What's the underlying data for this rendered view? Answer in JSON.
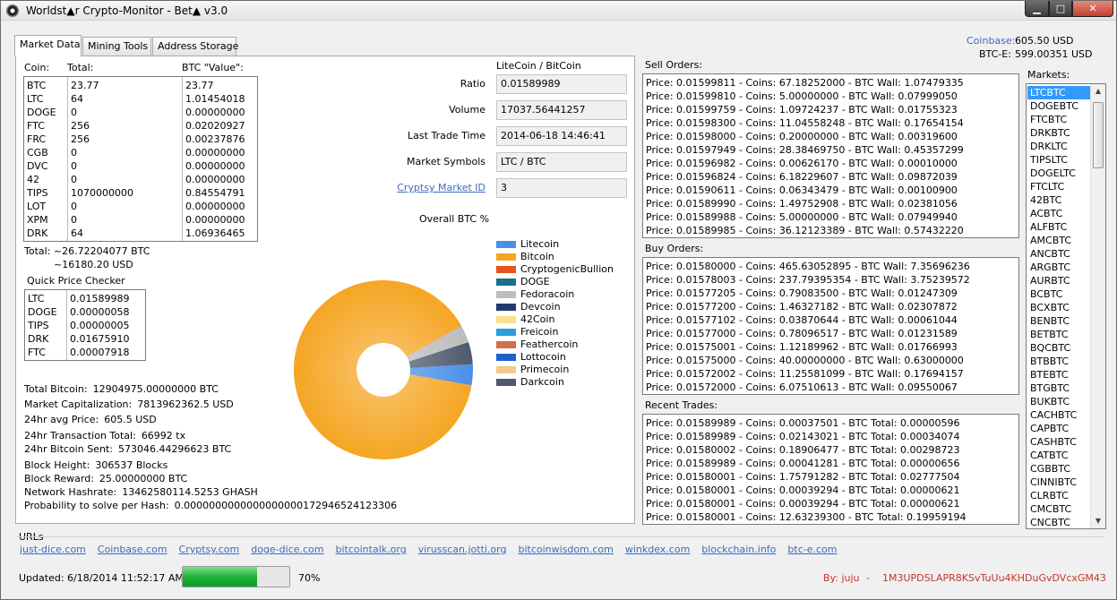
{
  "window": {
    "title": "Worldst▲r Crypto-Monitor - Bet▲ v3.0",
    "min_glyph": "▁",
    "max_glyph": "□",
    "close_glyph": "✕"
  },
  "tabs": [
    "Market Data",
    "Mining Tools",
    "Address Storage"
  ],
  "exchange_prices": {
    "coinbase_label": "Coinbase:",
    "coinbase_value": "605.50 USD",
    "btce_label": "BTC-E:",
    "btce_value": "599.00351 USD"
  },
  "portfolio": {
    "headers": [
      "Coin:",
      "Total:",
      "BTC \"Value\":"
    ],
    "rows": [
      {
        "coin": "BTC",
        "total": "23.77",
        "value": "23.77"
      },
      {
        "coin": "LTC",
        "total": "64",
        "value": "1.01454018"
      },
      {
        "coin": "DOGE",
        "total": "0",
        "value": "0.00000000"
      },
      {
        "coin": "FTC",
        "total": "256",
        "value": "0.02020927"
      },
      {
        "coin": "FRC",
        "total": "256",
        "value": "0.00237876"
      },
      {
        "coin": "CGB",
        "total": "0",
        "value": "0.00000000"
      },
      {
        "coin": "DVC",
        "total": "0",
        "value": "0.00000000"
      },
      {
        "coin": "42",
        "total": "0",
        "value": "0.00000000"
      },
      {
        "coin": "TIPS",
        "total": "1070000000",
        "value": "0.84554791"
      },
      {
        "coin": "LOT",
        "total": "0",
        "value": "0.00000000"
      },
      {
        "coin": "XPM",
        "total": "0",
        "value": "0.00000000"
      },
      {
        "coin": "DRK",
        "total": "64",
        "value": "1.06936465"
      }
    ],
    "total_btc": "Total:  ~26.72204077 BTC",
    "total_usd": "~16180.20 USD"
  },
  "quick_price": {
    "title": "Quick Price Checker",
    "rows": [
      {
        "coin": "LTC",
        "price": "0.01589989"
      },
      {
        "coin": "DOGE",
        "price": "0.00000058"
      },
      {
        "coin": "TIPS",
        "price": "0.00000005"
      },
      {
        "coin": "DRK",
        "price": "0.01675910"
      },
      {
        "coin": "FTC",
        "price": "0.00007918"
      }
    ]
  },
  "network_stats": [
    {
      "label": "Total Bitcoin:",
      "value": "12904975.00000000 BTC"
    },
    {
      "label": "Market Capitalization:",
      "value": "7813962362.5 USD"
    },
    {
      "label": "24hr avg Price:",
      "value": "605.5 USD"
    },
    {
      "label": "24hr Transaction Total:",
      "value": "66992 tx"
    },
    {
      "label": "24hr Bitcoin Sent:",
      "value": "573046.44296623 BTC"
    },
    {
      "label": "Block Height:",
      "value": "306537 Blocks"
    },
    {
      "label": "Block Reward:",
      "value": "25.00000000 BTC"
    },
    {
      "label": "Network Hashrate:",
      "value": "13462580114.5253 GHASH"
    },
    {
      "label": "Probability to solve per Hash:",
      "value": "0.0000000000000000000172946524123306"
    }
  ],
  "market": {
    "pair_title": "LiteCoin / BitCoin",
    "fields": [
      {
        "label": "Ratio",
        "value": "0.01589989"
      },
      {
        "label": "Volume",
        "value": "17037.56441257"
      },
      {
        "label": "Last Trade Time",
        "value": "2014-06-18 14:46:41"
      },
      {
        "label": "Market Symbols",
        "value": "LTC / BTC"
      },
      {
        "label": "Cryptsy Market ID",
        "value": "3"
      }
    ],
    "overall_label": "Overall BTC %"
  },
  "legend": [
    {
      "name": "Litecoin",
      "color": "#4a8fe7"
    },
    {
      "name": "Bitcoin",
      "color": "#f5a623"
    },
    {
      "name": "CryptogenicBullion",
      "color": "#e8541a"
    },
    {
      "name": "DOGE",
      "color": "#1a6f8f"
    },
    {
      "name": "Fedoracoin",
      "color": "#bdbdbd"
    },
    {
      "name": "Devcoin",
      "color": "#223a6e"
    },
    {
      "name": "42Coin",
      "color": "#f9e08a"
    },
    {
      "name": "Freicoin",
      "color": "#2a9fd8"
    },
    {
      "name": "Feathercoin",
      "color": "#d0704a"
    },
    {
      "name": "Lottocoin",
      "color": "#1d62c9"
    },
    {
      "name": "Primecoin",
      "color": "#f5c98a"
    },
    {
      "name": "Darkcoin",
      "color": "#4d5a6e"
    }
  ],
  "pie": {
    "slices": [
      {
        "name": "Bitcoin",
        "percent": 88.95,
        "color": "#f5a623"
      },
      {
        "name": "Litecoin",
        "percent": 3.8,
        "color": "#4a8fe7"
      },
      {
        "name": "Darkcoin",
        "percent": 4.0,
        "color": "#4d5a6e"
      },
      {
        "name": "TIPS",
        "percent": 3.16,
        "color": "#bdbdbd"
      },
      {
        "name": "Feathercoin",
        "percent": 0.08,
        "color": "#d0704a"
      }
    ]
  },
  "sell_orders": {
    "title": "Sell Orders:",
    "rows": [
      "Price: 0.01599811 - Coins: 67.18252000 - BTC Wall: 1.07479335",
      "Price: 0.01599810 - Coins: 5.00000000 - BTC Wall: 0.07999050",
      "Price: 0.01599759 - Coins: 1.09724237 - BTC Wall: 0.01755323",
      "Price: 0.01598300 - Coins: 11.04558248 - BTC Wall: 0.17654154",
      "Price: 0.01598000 - Coins: 0.20000000 - BTC Wall: 0.00319600",
      "Price: 0.01597949 - Coins: 28.38469750 - BTC Wall: 0.45357299",
      "Price: 0.01596982 - Coins: 0.00626170 - BTC Wall: 0.00010000",
      "Price: 0.01596824 - Coins: 6.18229607 - BTC Wall: 0.09872039",
      "Price: 0.01590611 - Coins: 0.06343479 - BTC Wall: 0.00100900",
      "Price: 0.01589990 - Coins: 1.49752908 - BTC Wall: 0.02381056",
      "Price: 0.01589988 - Coins: 5.00000000 - BTC Wall: 0.07949940",
      "Price: 0.01589985 - Coins: 36.12123389 - BTC Wall: 0.57432220"
    ]
  },
  "buy_orders": {
    "title": "Buy Orders:",
    "rows": [
      "Price: 0.01580000 - Coins: 465.63052895 - BTC Wall: 7.35696236",
      "Price: 0.01578003 - Coins: 237.79395354 - BTC Wall: 3.75239572",
      "Price: 0.01577205 - Coins: 0.79083500 - BTC Wall: 0.01247309",
      "Price: 0.01577200 - Coins: 1.46327182 - BTC Wall: 0.02307872",
      "Price: 0.01577102 - Coins: 0.03870644 - BTC Wall: 0.00061044",
      "Price: 0.01577000 - Coins: 0.78096517 - BTC Wall: 0.01231589",
      "Price: 0.01575001 - Coins: 1.12189962 - BTC Wall: 0.01766993",
      "Price: 0.01575000 - Coins: 40.00000000 - BTC Wall: 0.63000000",
      "Price: 0.01572002 - Coins: 11.25581099 - BTC Wall: 0.17694157",
      "Price: 0.01572000 - Coins: 6.07510613 - BTC Wall: 0.09550067"
    ]
  },
  "recent_trades": {
    "title": "Recent Trades:",
    "rows": [
      "Price: 0.01589989 - Coins: 0.00037501 - BTC Total: 0.00000596",
      "Price: 0.01589989 - Coins: 0.02143021 - BTC Total: 0.00034074",
      "Price: 0.01580002 - Coins: 0.18906477 - BTC Total: 0.00298723",
      "Price: 0.01589989 - Coins: 0.00041281 - BTC Total: 0.00000656",
      "Price: 0.01580001 - Coins: 1.75791282 - BTC Total: 0.02777504",
      "Price: 0.01580001 - Coins: 0.00039294 - BTC Total: 0.00000621",
      "Price: 0.01580001 - Coins: 0.00039294 - BTC Total: 0.00000621",
      "Price: 0.01580001 - Coins: 12.63239300 - BTC Total: 0.19959194"
    ]
  },
  "markets": {
    "title": "Markets:",
    "selected": "LTCBTC",
    "items": [
      "LTCBTC",
      "DOGEBTC",
      "FTCBTC",
      "DRKBTC",
      "DRKLTC",
      "TIPSLTC",
      "DOGELTC",
      "FTCLTC",
      "42BTC",
      "ACBTC",
      "ALFBTC",
      "AMCBTC",
      "ANCBTC",
      "ARGBTC",
      "AURBTC",
      "BCBTC",
      "BCXBTC",
      "BENBTC",
      "BETBTC",
      "BQCBTC",
      "BTBBTC",
      "BTEBTC",
      "BTGBTC",
      "BUKBTC",
      "CACHBTC",
      "CAPBTC",
      "CASHBTC",
      "CATBTC",
      "CGBBTC",
      "CINNIBTC",
      "CLRBTC",
      "CMCBTC",
      "CNCBTC"
    ]
  },
  "urls": {
    "title": "URLs",
    "links": [
      "just-dice.com",
      "Coinbase.com",
      "Cryptsy.com",
      "doge-dice.com",
      "bitcointalk.org",
      "virusscan.jotti.org",
      "bitcoinwisdom.com",
      "winkdex.com",
      "blockchain.info",
      "btc-e.com"
    ]
  },
  "status": {
    "updated": "Updated: 6/18/2014 11:52:17 AM",
    "progress_percent": 70,
    "progress_text": "70%",
    "by_label": "By: juju",
    "dash": "-",
    "donation_address": "1M3UPDSLAPR8KSvTuUu4KHDuGvDVcxGM43"
  },
  "colors": {
    "link": "#3a6bbf",
    "selection": "#3399ff",
    "footer_red": "#c0392b",
    "progress_green": "#1fb43a"
  }
}
